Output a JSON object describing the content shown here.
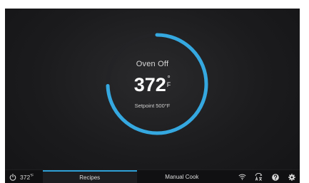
{
  "dial": {
    "status": "Oven Off",
    "temperature": "372",
    "unit": "F",
    "setpoint": "Setpoint 500°F",
    "progress_fraction": 0.744,
    "accent_color": "#35a8e0",
    "track_color": "#232326"
  },
  "navbar": {
    "current_temp": "372",
    "current_temp_unit": "°F",
    "tabs": [
      {
        "label": "Recipes",
        "active": true
      },
      {
        "label": "Manual Cook",
        "active": false
      }
    ],
    "icons": [
      "wifi-icon",
      "language-icon",
      "help-icon",
      "settings-icon"
    ]
  }
}
